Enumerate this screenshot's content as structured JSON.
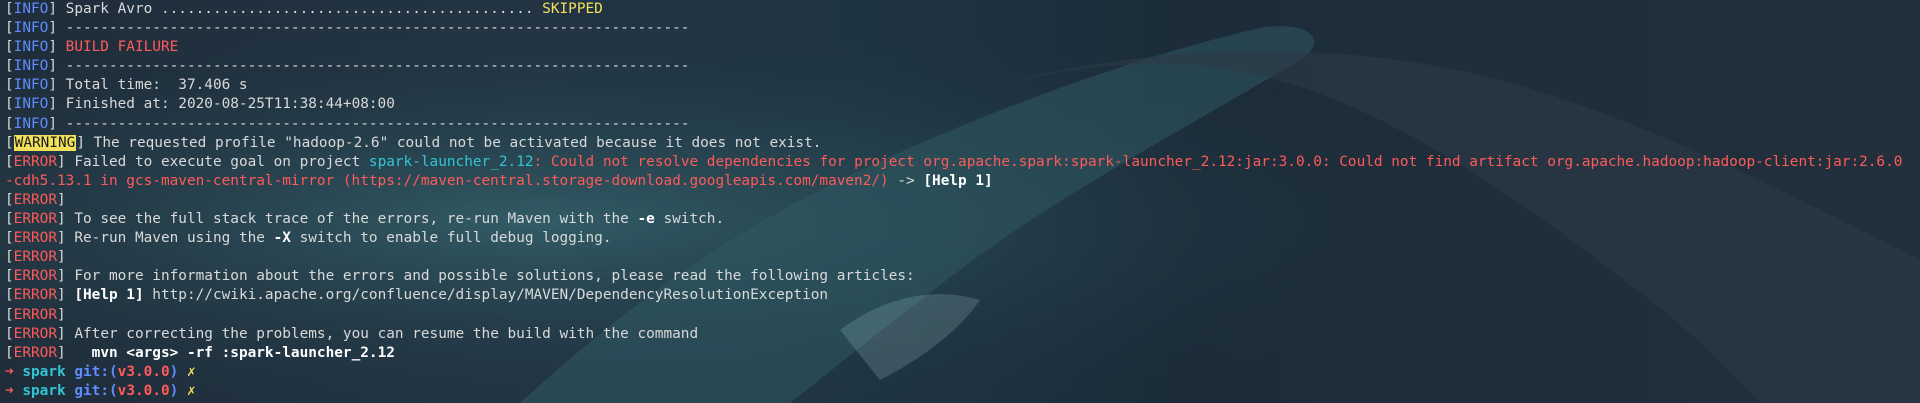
{
  "lines": [
    {
      "tag": "INFO",
      "text": "Spark Avro ........................................... ",
      "status": "SKIPPED"
    },
    {
      "tag": "INFO",
      "text": "------------------------------------------------------------------------"
    },
    {
      "tag": "INFO",
      "status": "BUILD FAILURE"
    },
    {
      "tag": "INFO",
      "text": "------------------------------------------------------------------------"
    },
    {
      "tag": "INFO",
      "text": "Total time:  37.406 s"
    },
    {
      "tag": "INFO",
      "text": "Finished at: 2020-08-25T11:38:44+08:00"
    },
    {
      "tag": "INFO",
      "text": "------------------------------------------------------------------------"
    },
    {
      "tag": "WARNING",
      "text": "The requested profile \"hadoop-2.6\" could not be activated because it does not exist."
    },
    {
      "tag": "ERROR",
      "pre": "Failed to execute goal on project ",
      "project": "spark-launcher_2.12",
      "msg": ": Could not resolve dependencies for project org.apache.spark:spark-launcher_2.12:jar:3.0.0: Could not find artifact org.apache.hadoop:hadoop-client:jar:2.6.0-cdh5.13.1 in gcs-maven-central-mirror (https://maven-central.storage-download.googleapis.com/maven2/)",
      "post": " -> ",
      "help": "[Help 1]"
    },
    {
      "tag": "ERROR"
    },
    {
      "tag": "ERROR",
      "pre": "To see the full stack trace of the errors, re-run Maven with the ",
      "flag": "-e",
      "post": " switch."
    },
    {
      "tag": "ERROR",
      "pre": "Re-run Maven using the ",
      "flag": "-X",
      "post": " switch to enable full debug logging."
    },
    {
      "tag": "ERROR"
    },
    {
      "tag": "ERROR",
      "text": "For more information about the errors and possible solutions, please read the following articles:"
    },
    {
      "tag": "ERROR",
      "help": "[Help 1]",
      "post": " http://cwiki.apache.org/confluence/display/MAVEN/DependencyResolutionException"
    },
    {
      "tag": "ERROR"
    },
    {
      "tag": "ERROR",
      "text": "After correcting the problems, you can resume the build with the command"
    },
    {
      "tag": "ERROR",
      "command": "  mvn <args> -rf :spark-launcher_2.12"
    }
  ],
  "prompts": [
    {
      "arrow": "➜",
      "dir": "spark",
      "git_prefix": "git:(",
      "branch": "v3.0.0",
      "git_suffix": ")",
      "dirty": "✗"
    },
    {
      "arrow": "➜",
      "dir": "spark",
      "git_prefix": "git:(",
      "branch": "v3.0.0",
      "git_suffix": ")",
      "dirty": "✗"
    }
  ],
  "colors": {
    "info_tag": "#5f8cff",
    "error_tag": "#ff5a5a",
    "warning_bg": "#f0e05a",
    "skipped": "#f0e05a",
    "project": "#33c5d3"
  }
}
